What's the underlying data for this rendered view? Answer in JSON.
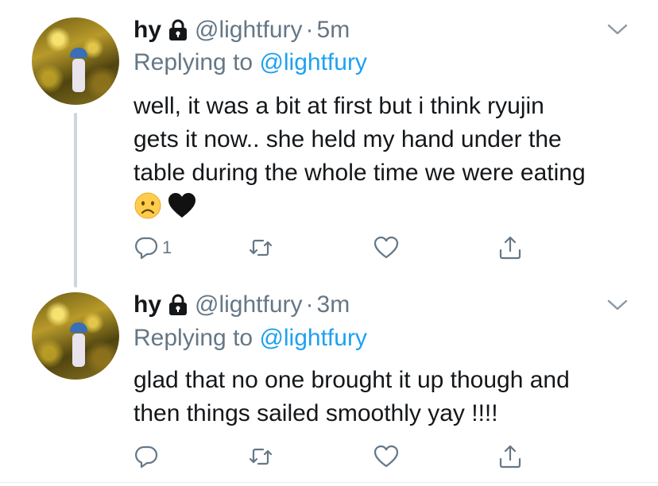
{
  "colors": {
    "accent": "#1da1f2",
    "secondary_text": "#657786",
    "thread_line": "#ccd6dd"
  },
  "tweets": [
    {
      "name": "hy",
      "handle": "@lightfury",
      "separator": "·",
      "time": "5m",
      "replying_prefix": "Replying to",
      "replying_handle": "@lightfury",
      "text_lines": [
        "well, it was a bit at first but i think ryujin",
        "gets it now.. she held my hand under the",
        "table during the whole time we were eating"
      ],
      "emojis": [
        "frowning-face",
        "black-heart"
      ],
      "reply_count": "1"
    },
    {
      "name": "hy",
      "handle": "@lightfury",
      "separator": "·",
      "time": "3m",
      "replying_prefix": "Replying to",
      "replying_handle": "@lightfury",
      "text_lines": [
        "glad that no one brought it up though and",
        "then things sailed smoothly yay !!!!"
      ],
      "emojis": [],
      "reply_count": ""
    }
  ]
}
